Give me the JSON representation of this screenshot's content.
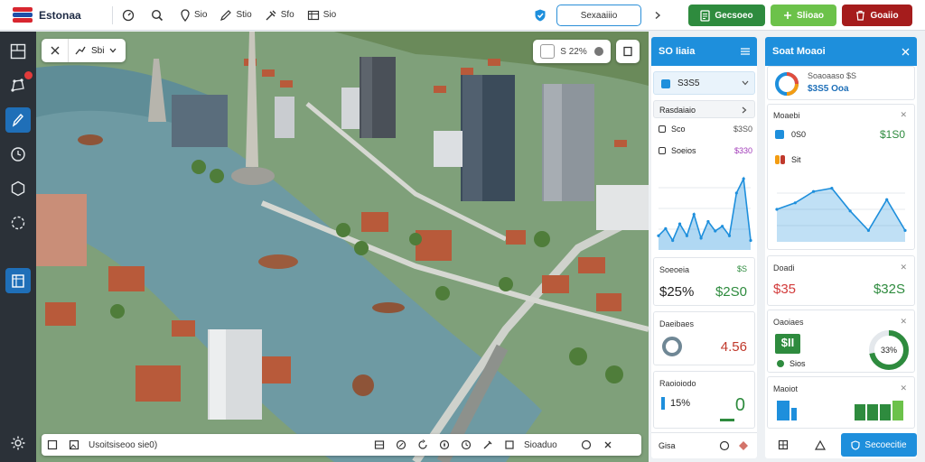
{
  "app": {
    "title": "Estonaa"
  },
  "toolbar": {
    "tools": [
      {
        "label": "",
        "icon": "gauge-icon"
      },
      {
        "label": "",
        "icon": "search-icon"
      },
      {
        "label": "Sio",
        "icon": "pin-icon"
      },
      {
        "label": "Stio",
        "icon": "pencil-icon"
      },
      {
        "label": "Sfo",
        "icon": "tools-icon"
      },
      {
        "label": "Sio",
        "icon": "table-icon"
      }
    ],
    "search_label": "Sexaaiiio",
    "btn_primary": "Gecsoeo",
    "btn_secondary": "Slioao",
    "btn_danger": "Goaiio"
  },
  "map": {
    "layer_label": "Sbi",
    "zoom_label": "S 22%",
    "coords_label": "Usoitsiseoo sie0)",
    "status_label": "Sioaduo"
  },
  "panel_left": {
    "title": "SO Iiaia",
    "selected_label": "S3S5",
    "section_label": "Rasdaiaio",
    "rows": [
      {
        "label": "Sco",
        "value": "$3S0"
      },
      {
        "label": "Soeios",
        "value": "$330"
      }
    ],
    "chart": {
      "title": "",
      "values": [
        12,
        18,
        8,
        22,
        12,
        30,
        10,
        24,
        16,
        20,
        12,
        48,
        60,
        8
      ],
      "ylim": [
        0,
        70
      ]
    },
    "cards": [
      {
        "title": "Soeoeia",
        "value": "$25%",
        "value2": "$2S0",
        "flag": "$S"
      },
      {
        "title": "Daeibaes",
        "value": "4.56"
      },
      {
        "title": "Raoioiodo",
        "value": "15%",
        "value2": "0"
      }
    ],
    "footer": "Gisa"
  },
  "panel_right": {
    "title": "Soat Moaoi",
    "summary": {
      "line1": "Soaoaaso $S",
      "line2": "$3S5 Ooa"
    },
    "card1": {
      "title": "Moaebi",
      "stat_label": "0S0",
      "stat_value": "$1S0",
      "tag_label": "Sit",
      "chart": {
        "values": [
          40,
          48,
          62,
          66,
          38,
          14,
          52,
          14
        ],
        "ylim": [
          0,
          80
        ]
      }
    },
    "card2": {
      "title": "Doadi",
      "value": "$35",
      "value2": "$32S"
    },
    "card3": {
      "title": "Oaoiaes",
      "value": "$II",
      "legend": "Sios",
      "gauge_label": "33%",
      "gauge_value": 0.72
    },
    "card4": {
      "title": "Maoiot"
    },
    "footer_btn": "Secoecitie"
  },
  "colors": {
    "accent": "#1e8fdc",
    "green": "#2e8b3e",
    "light_green": "#6cc24a",
    "red": "#a51c1c",
    "danger_text": "#d23a3a"
  }
}
